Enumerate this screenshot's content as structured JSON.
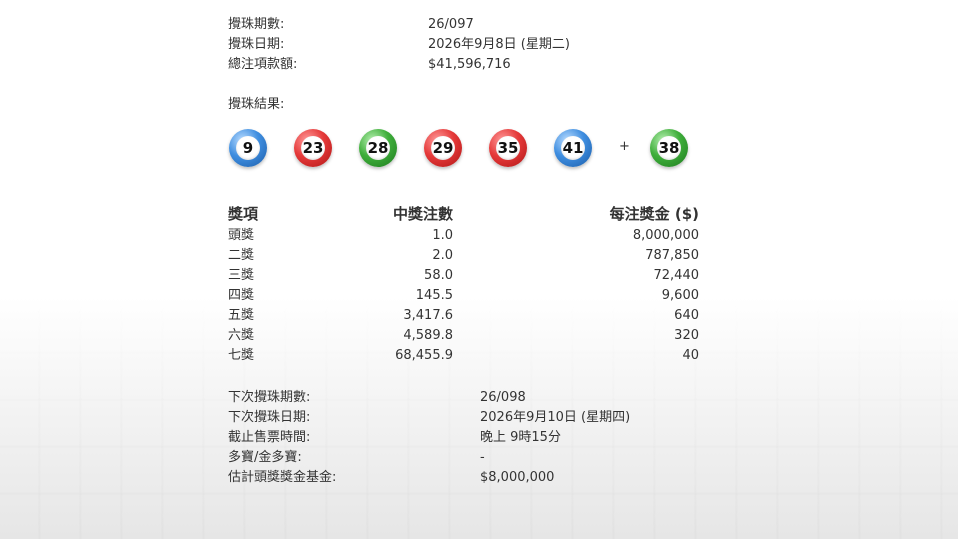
{
  "draw_info": {
    "draw_no_label": "攪珠期數:",
    "draw_no": "26/097",
    "draw_date_label": "攪珠日期:",
    "draw_date": "2026年9月8日 (星期二)",
    "turnover_label": "總注項款額:",
    "turnover": "$41,596,716"
  },
  "results": {
    "label": "攪珠結果:",
    "balls": [
      {
        "number": "9",
        "color": "blue"
      },
      {
        "number": "23",
        "color": "red"
      },
      {
        "number": "28",
        "color": "green"
      },
      {
        "number": "29",
        "color": "red"
      },
      {
        "number": "35",
        "color": "red"
      },
      {
        "number": "41",
        "color": "blue"
      }
    ],
    "plus": "+",
    "extra_ball": {
      "number": "38",
      "color": "green"
    }
  },
  "prize_table": {
    "headers": [
      "獎項",
      "中獎注數",
      "每注獎金 ($)"
    ],
    "rows": [
      {
        "prize": "頭獎",
        "winners": "1.0",
        "amount": "8,000,000"
      },
      {
        "prize": "二獎",
        "winners": "2.0",
        "amount": "787,850"
      },
      {
        "prize": "三獎",
        "winners": "58.0",
        "amount": "72,440"
      },
      {
        "prize": "四獎",
        "winners": "145.5",
        "amount": "9,600"
      },
      {
        "prize": "五獎",
        "winners": "3,417.6",
        "amount": "640"
      },
      {
        "prize": "六獎",
        "winners": "4,589.8",
        "amount": "320"
      },
      {
        "prize": "七獎",
        "winners": "68,455.9",
        "amount": "40"
      }
    ]
  },
  "next_draw": {
    "draw_no_label": "下次攪珠期數:",
    "draw_no": "26/098",
    "date_label": "下次攪珠日期:",
    "date": "2026年9月10日 (星期四)",
    "cutoff_label": "截止售票時間:",
    "cutoff": "晚上 9時15分",
    "snowball_label": "多寶/金多寶:",
    "snowball": "-",
    "jackpot_label": "估計頭獎獎金基金:",
    "jackpot": "$8,000,000"
  },
  "colors": {
    "red": "#e53a3a",
    "blue": "#3f8ee0",
    "green": "#3fae3b",
    "text": "#333333"
  }
}
